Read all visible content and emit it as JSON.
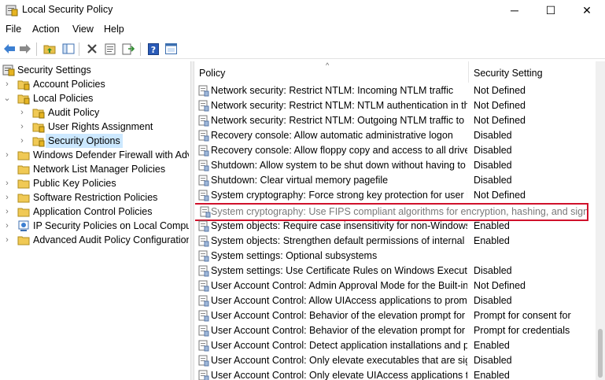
{
  "window": {
    "title": "Local Security Policy",
    "minimize": "─",
    "maximize": "☐",
    "close": "✕"
  },
  "menu": [
    "File",
    "Action",
    "View",
    "Help"
  ],
  "tree": [
    {
      "label": "Security Settings"
    },
    {
      "label": "Account Policies"
    },
    {
      "label": "Local Policies"
    },
    {
      "label": "Audit Policy"
    },
    {
      "label": "User Rights Assignment"
    },
    {
      "label": "Security Options"
    },
    {
      "label": "Windows Defender Firewall with Adva"
    },
    {
      "label": "Network List Manager Policies"
    },
    {
      "label": "Public Key Policies"
    },
    {
      "label": "Software Restriction Policies"
    },
    {
      "label": "Application Control Policies"
    },
    {
      "label": "IP Security Policies on Local Compute"
    },
    {
      "label": "Advanced Audit Policy Configuration"
    }
  ],
  "columns": {
    "policy": "Policy",
    "setting": "Security Setting"
  },
  "rows": [
    {
      "policy": "Network security: Restrict NTLM: Incoming NTLM traffic",
      "setting": "Not Defined"
    },
    {
      "policy": "Network security: Restrict NTLM: NTLM authentication in this domain",
      "setting": "Not Defined"
    },
    {
      "policy": "Network security: Restrict NTLM: Outgoing NTLM traffic to remote servers",
      "setting": "Not Defined"
    },
    {
      "policy": "Recovery console: Allow automatic administrative logon",
      "setting": "Disabled"
    },
    {
      "policy": "Recovery console: Allow floppy copy and access to all drives and folders",
      "setting": "Disabled"
    },
    {
      "policy": "Shutdown: Allow system to be shut down without having to log on",
      "setting": "Disabled"
    },
    {
      "policy": "Shutdown: Clear virtual memory pagefile",
      "setting": "Disabled"
    },
    {
      "policy": "System cryptography: Force strong key protection for user keys stored on the computer",
      "setting": "Not Defined"
    },
    {
      "policy": "System cryptography: Use FIPS compliant algorithms for encryption, hashing, and signing",
      "setting": "",
      "highlight": true
    },
    {
      "policy": "System objects: Require case insensitivity for non-Windows subsystems",
      "setting": "Enabled"
    },
    {
      "policy": "System objects: Strengthen default permissions of internal system objects",
      "setting": "Enabled"
    },
    {
      "policy": "System settings: Optional subsystems",
      "setting": ""
    },
    {
      "policy": "System settings: Use Certificate Rules on Windows Executables for Software Restriction Policies",
      "setting": "Disabled"
    },
    {
      "policy": "User Account Control: Admin Approval Mode for the Built-in Administrator account",
      "setting": "Not Defined"
    },
    {
      "policy": "User Account Control: Allow UIAccess applications to prompt for elevation",
      "setting": "Disabled"
    },
    {
      "policy": "User Account Control: Behavior of the elevation prompt for administrators",
      "setting": "Prompt for consent for"
    },
    {
      "policy": "User Account Control: Behavior of the elevation prompt for standard users",
      "setting": "Prompt for credentials"
    },
    {
      "policy": "User Account Control: Detect application installations and prompt for elevation",
      "setting": "Enabled"
    },
    {
      "policy": "User Account Control: Only elevate executables that are signed and validated",
      "setting": "Disabled"
    },
    {
      "policy": "User Account Control: Only elevate UIAccess applications that are installed in secure locations",
      "setting": "Enabled"
    }
  ]
}
